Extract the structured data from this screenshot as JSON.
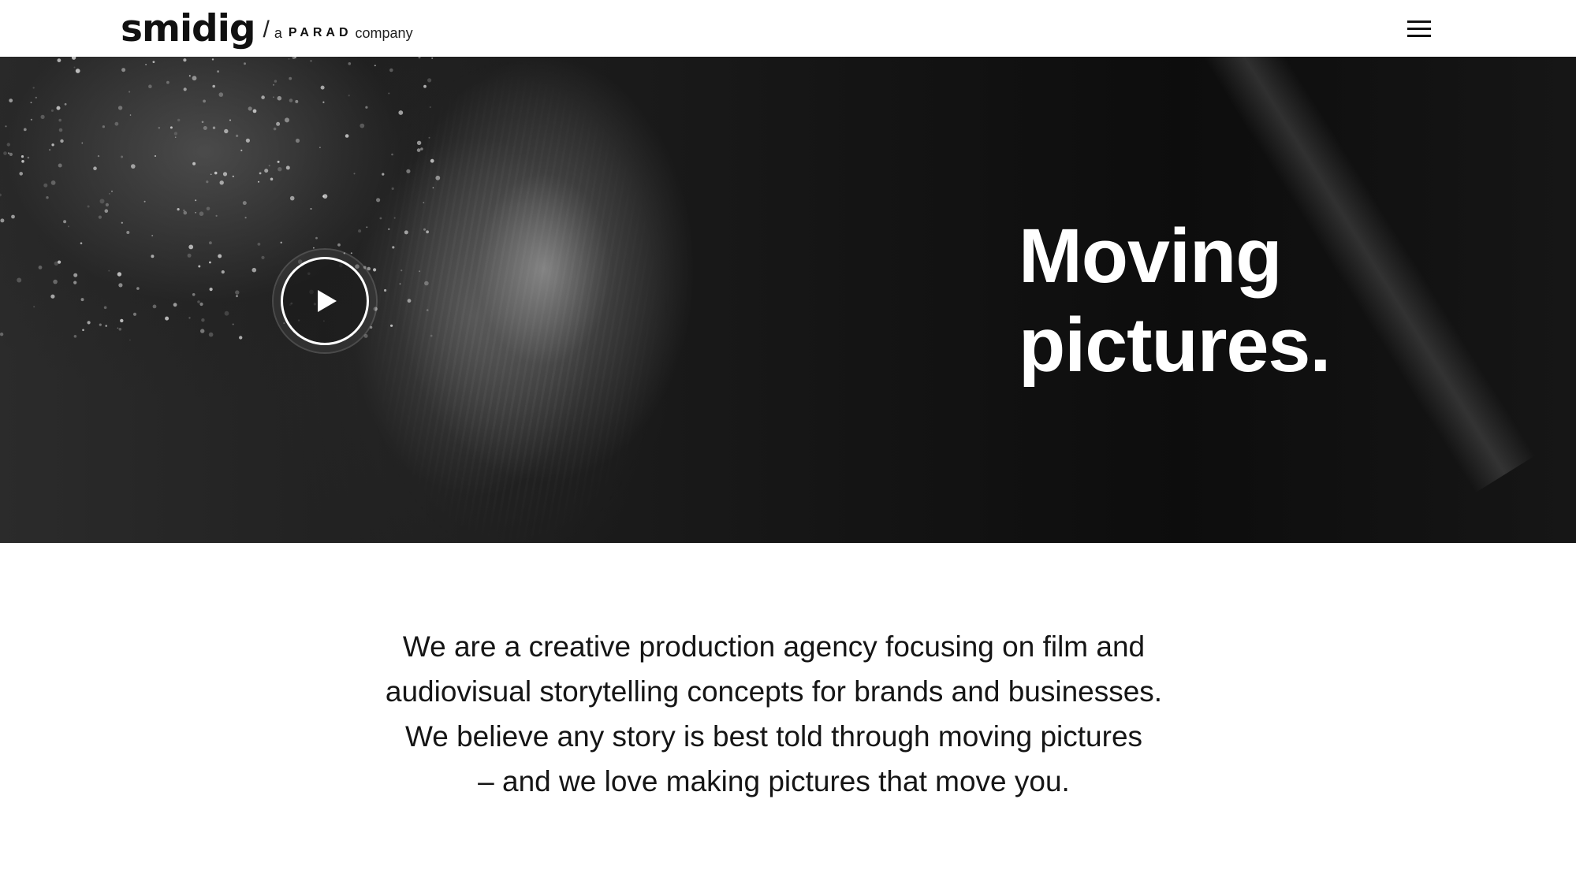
{
  "header": {
    "logo": "smidig",
    "slash": "/",
    "tagline_prefix": "a",
    "tagline_brand": "PARAD",
    "tagline_suffix": "company",
    "menu_icon": "hamburger-menu-icon"
  },
  "hero": {
    "play_icon": "play-icon",
    "title_lines": [
      "Moving",
      "pictures."
    ]
  },
  "intro": {
    "lines": [
      "We are a creative production agency focusing on film and",
      "audiovisual storytelling concepts for brands and businesses.",
      "We believe any story is best told through moving pictures",
      "– and we love making pictures that move you."
    ]
  },
  "colors": {
    "background": "#ffffff",
    "text": "#111111",
    "hero_text": "#ffffff"
  }
}
